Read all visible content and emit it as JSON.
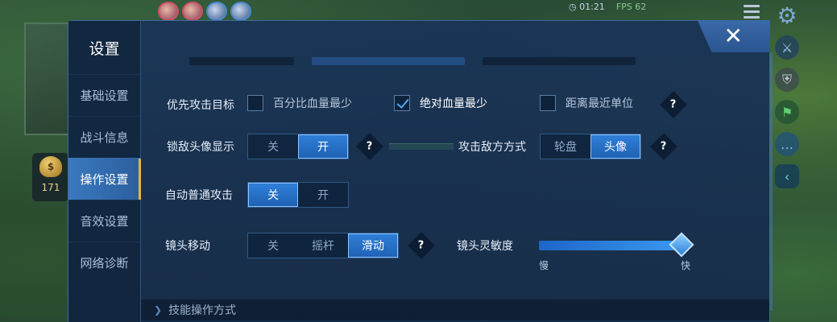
{
  "hud": {
    "timer": "01:21",
    "fps": "FPS 62",
    "gold": "171"
  },
  "settings": {
    "title": "设置",
    "nav": [
      {
        "label": "基础设置",
        "active": false
      },
      {
        "label": "战斗信息",
        "active": false
      },
      {
        "label": "操作设置",
        "active": true
      },
      {
        "label": "音效设置",
        "active": false
      },
      {
        "label": "网络诊断",
        "active": false
      }
    ],
    "priority_target": {
      "label": "优先攻击目标",
      "options": [
        {
          "label": "百分比血量最少",
          "checked": false
        },
        {
          "label": "绝对血量最少",
          "checked": true
        },
        {
          "label": "距离最近单位",
          "checked": false
        }
      ]
    },
    "lock_avatar": {
      "label": "锁敌头像显示",
      "options": [
        "关",
        "开"
      ],
      "selected": "开"
    },
    "attack_mode": {
      "label": "攻击敌方方式",
      "options": [
        "轮盘",
        "头像"
      ],
      "selected": "头像"
    },
    "auto_attack": {
      "label": "自动普通攻击",
      "options": [
        "关",
        "开"
      ],
      "selected": "关"
    },
    "camera_move": {
      "label": "镜头移动",
      "options": [
        "关",
        "摇杆",
        "滑动"
      ],
      "selected": "滑动"
    },
    "camera_sensitivity": {
      "label": "镜头灵敏度",
      "min_label": "慢",
      "max_label": "快",
      "value": 0.93
    },
    "help_glyph": "?",
    "close_glyph": "✕",
    "footer_label": "技能操作方式"
  }
}
